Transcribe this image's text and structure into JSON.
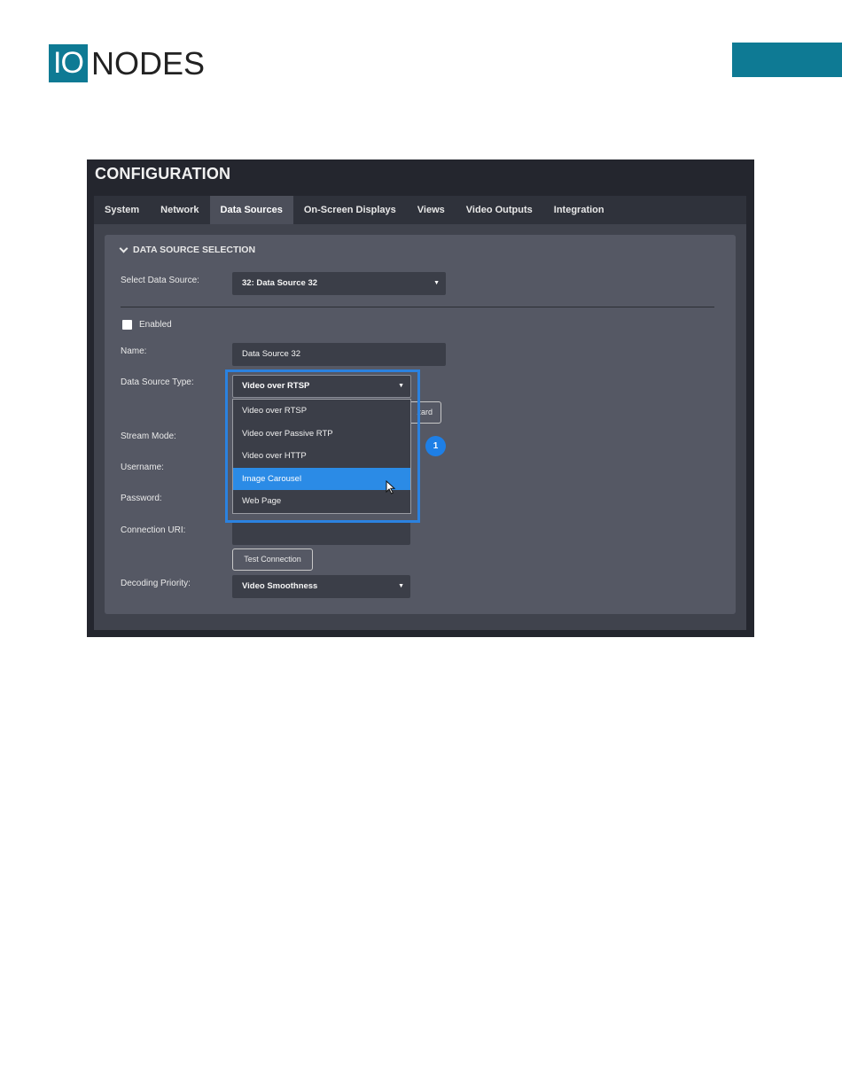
{
  "doc": {
    "logo_left": "IO",
    "logo_right": "NODES"
  },
  "page": {
    "title": "CONFIGURATION"
  },
  "tabs": [
    "System",
    "Network",
    "Data Sources",
    "On-Screen Displays",
    "Views",
    "Video Outputs",
    "Integration"
  ],
  "active_tab": "Data Sources",
  "section": {
    "title": "DATA SOURCE SELECTION"
  },
  "form": {
    "select_source_label": "Select Data Source:",
    "select_source_value": "32: Data Source 32",
    "enabled_label": "Enabled",
    "enabled_checked": false,
    "name_label": "Name:",
    "name_value": "Data Source 32",
    "type_label": "Data Source Type:",
    "type_value": "Video over RTSP",
    "wizard_label_partial": "zard",
    "stream_mode_label": "Stream Mode:",
    "username_label": "Username:",
    "password_label": "Password:",
    "uri_label": "Connection URI:",
    "test_connection_label": "Test Connection",
    "decoding_label": "Decoding Priority:",
    "decoding_value": "Video Smoothness"
  },
  "dropdown": {
    "options": [
      "Video over RTSP",
      "Video over Passive RTP",
      "Video over HTTP",
      "Image Carousel",
      "Web Page"
    ],
    "hovered": "Image Carousel"
  },
  "callout": {
    "number": "1"
  },
  "colors": {
    "brand": "#0e7a94",
    "highlight": "#2b82e0",
    "hover": "#2b8be6"
  }
}
